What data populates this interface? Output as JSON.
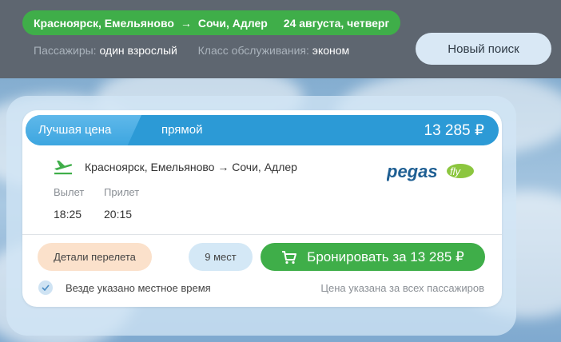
{
  "header": {
    "origin": "Красноярск, Емельяново",
    "arrow": "→",
    "destination": "Сочи, Адлер",
    "date": "24 августа, четверг",
    "passengers_label": "Пассажиры:",
    "passengers_value": "один взрослый",
    "class_label": "Класс обслуживания:",
    "class_value": "эконом",
    "new_search_label": "Новый поиск"
  },
  "offer": {
    "badge": "Лучшая цена",
    "flight_type": "прямой",
    "price": "13 285 ₽",
    "route": "Красноярск, Емельяново → Сочи, Адлер",
    "airline_logo": "pegas fly",
    "departure_label": "Вылет",
    "arrival_label": "Прилет",
    "departure_time": "18:25",
    "arrival_time": "20:15",
    "details_label": "Детали перелета",
    "seats_label": "9 мест",
    "book_label": "Бронировать за 13 285 ₽",
    "local_time_note": "Везде указано местное время",
    "price_note": "Цена указана за всех пассажиров"
  },
  "colors": {
    "green": "#3fae49",
    "blue": "#2c9ad6",
    "header_bg": "#5e6670"
  },
  "icons": [
    "plane-takeoff-icon",
    "cart-icon",
    "check-icon"
  ]
}
